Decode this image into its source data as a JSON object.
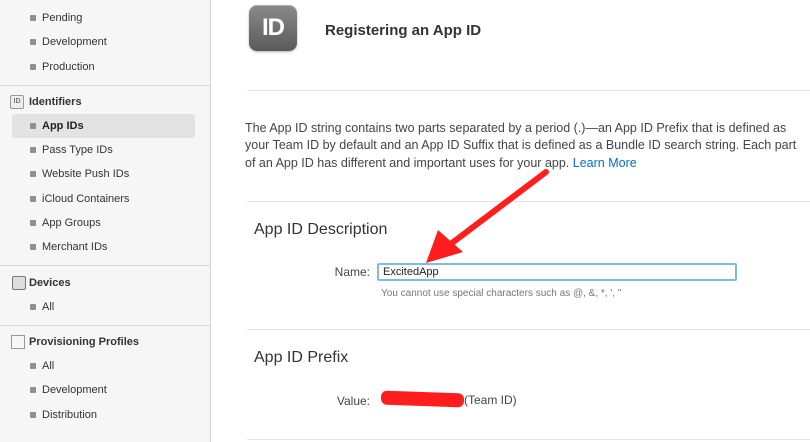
{
  "sidebar": {
    "certificates_items": [
      "Pending",
      "Development",
      "Production"
    ],
    "identifiers": {
      "header": "Identifiers",
      "badge": "ID",
      "items": [
        "App IDs",
        "Pass Type IDs",
        "Website Push IDs",
        "iCloud Containers",
        "App Groups",
        "Merchant IDs"
      ],
      "selected": "App IDs"
    },
    "devices": {
      "header": "Devices",
      "items": [
        "All"
      ]
    },
    "profiles": {
      "header": "Provisioning Profiles",
      "items": [
        "All",
        "Development",
        "Distribution"
      ]
    }
  },
  "main": {
    "icon_text": "ID",
    "title": "Registering an App ID",
    "intro": "The App ID string contains two parts separated by a period (.)—an App ID Prefix that is defined as your Team ID by default and an App ID Suffix that is defined as a Bundle ID search string. Each part of an App ID has different and important uses for your app.",
    "learn_more": "Learn More",
    "description_section": {
      "title": "App ID Description",
      "name_label": "Name:",
      "name_value": "ExcitedApp",
      "hint": "You cannot use special characters such as @, &, *, ', \""
    },
    "prefix_section": {
      "title": "App ID Prefix",
      "value_label": "Value:",
      "value_visible": "(Team ID)"
    }
  },
  "colors": {
    "link": "#0070c9",
    "annotation": "#ff1d1d",
    "input_focus": "#7fb7ee"
  }
}
